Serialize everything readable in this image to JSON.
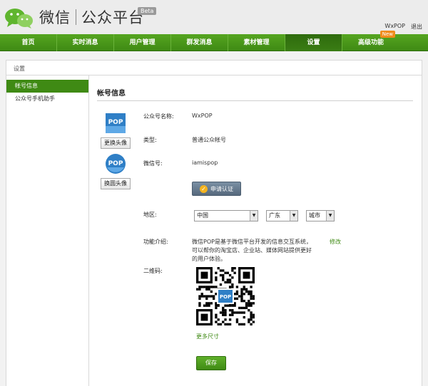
{
  "header": {
    "brand_main": "微信",
    "brand_sub": "公众平台",
    "beta": "Beta",
    "username": "WxPOP",
    "logout": "退出"
  },
  "nav": {
    "items": [
      {
        "label": "首页"
      },
      {
        "label": "实时消息"
      },
      {
        "label": "用户管理"
      },
      {
        "label": "群发消息"
      },
      {
        "label": "素材管理"
      },
      {
        "label": "设置"
      },
      {
        "label": "高级功能",
        "badge": "New"
      }
    ],
    "active_index": 5
  },
  "breadcrumb": "设置",
  "sidebar": {
    "items": [
      {
        "label": "帐号信息"
      },
      {
        "label": "公众号手机助手"
      }
    ]
  },
  "account": {
    "section_title": "帐号信息",
    "change_avatar": "更换头像",
    "change_round_avatar": "换圆头像",
    "avatar_text": "POP",
    "name_label": "公众号名称:",
    "name_value": "WxPOP",
    "type_label": "类型:",
    "type_value": "普通公众帐号",
    "wechat_label": "微信号:",
    "wechat_value": "iamispop",
    "apply_button": "申请认证",
    "region_label": "地区:",
    "country": "中国",
    "province": "广东",
    "city": "城市",
    "intro_label": "功能介绍:",
    "intro_line1": "微信POP是基于微信平台开发的信息交互系统，",
    "intro_line2": "可以帮你的淘宝店、企业站、媒体网站提供更好",
    "intro_line3": "的用户体验。",
    "edit_link": "修改",
    "qr_label": "二维码:",
    "more_sizes": "更多尺寸",
    "save_button": "保存"
  },
  "colors": {
    "nav_green": "#3f8a14",
    "accent_orange": "#f08c1c",
    "button_slate": "#56697d"
  }
}
